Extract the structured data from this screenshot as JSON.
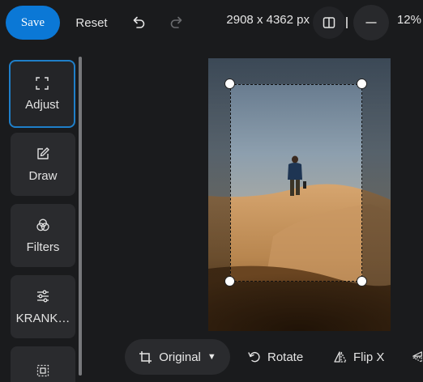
{
  "toolbar": {
    "save_label": "Save",
    "reset_label": "Reset",
    "image_size": "2908 x 4362 px",
    "zoom_level": "12%",
    "undo_icon": "undo-icon",
    "redo_icon": "redo-icon",
    "compare_icon": "split-view-icon",
    "zoom_out_icon": "minus-icon"
  },
  "sidebar": {
    "items": [
      {
        "label": "Adjust",
        "icon": "crop-corners-icon",
        "active": true
      },
      {
        "label": "Draw",
        "icon": "pencil-square-icon",
        "active": false
      },
      {
        "label": "Filters",
        "icon": "circles-icon",
        "active": false
      },
      {
        "label": "KRANK…",
        "icon": "sliders-icon",
        "active": false
      },
      {
        "label": "",
        "icon": "frame-icon",
        "active": false
      }
    ]
  },
  "bottom": {
    "ratio_label": "Original",
    "rotate_label": "Rotate",
    "flip_x_label": "Flip X"
  },
  "colors": {
    "accent": "#0b78d6",
    "background": "#1a1b1d",
    "panel": "#2a2b2e"
  }
}
